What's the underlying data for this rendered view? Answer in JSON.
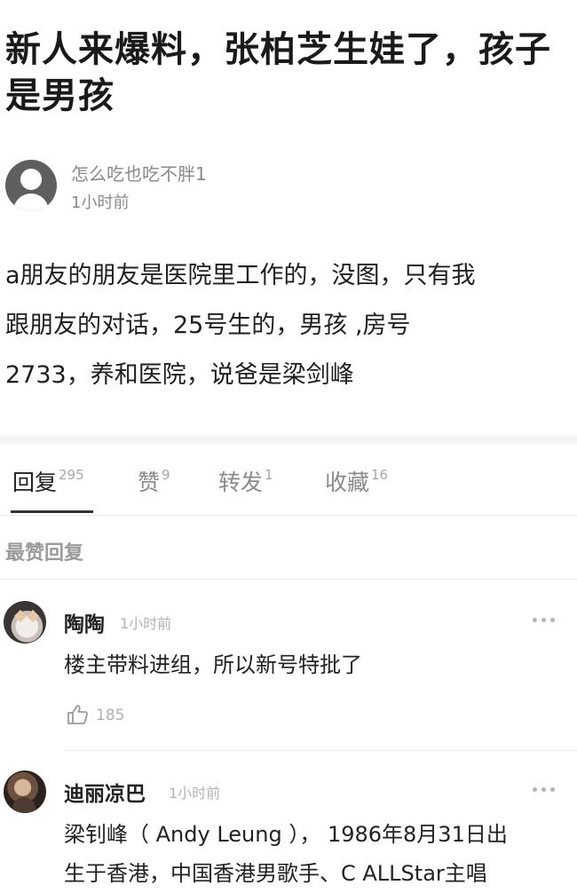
{
  "post": {
    "title": "新人来爆料，张柏芝生娃了，孩子是男孩",
    "author": {
      "name": "怎么吃也吃不胖1",
      "time": "1小时前"
    },
    "body_lines": [
      "a朋友的朋友是医院里工作的，没图，只有我",
      "跟朋友的对话，25号生的，男孩 ,房号",
      "2733，养和医院，说爸是梁剑峰"
    ]
  },
  "tabs": [
    {
      "label": "回复",
      "count": "295",
      "active": true
    },
    {
      "label": "赞",
      "count": "9",
      "active": false
    },
    {
      "label": "转发",
      "count": "1",
      "active": false
    },
    {
      "label": "收藏",
      "count": "16",
      "active": false
    }
  ],
  "section_title": "最赞回复",
  "comments": [
    {
      "name": "陶陶",
      "time": "1小时前",
      "text": "楼主带料进组，所以新号特批了",
      "likes": "185"
    },
    {
      "name": "迪丽凉巴",
      "time": "1小时前",
      "text_lines": [
        "梁钊峰（ Andy Leung ）， 1986年8月31日出",
        "生于香港，中国香港男歌手、C ALLStar主唱"
      ]
    }
  ],
  "icons": {
    "author_avatar": "default-user-avatar-icon",
    "more": "more-dots-icon",
    "like": "thumbs-up-icon"
  },
  "colors": {
    "text_primary": "#222222",
    "text_secondary": "#8a8a8a",
    "divider": "#ececec"
  }
}
